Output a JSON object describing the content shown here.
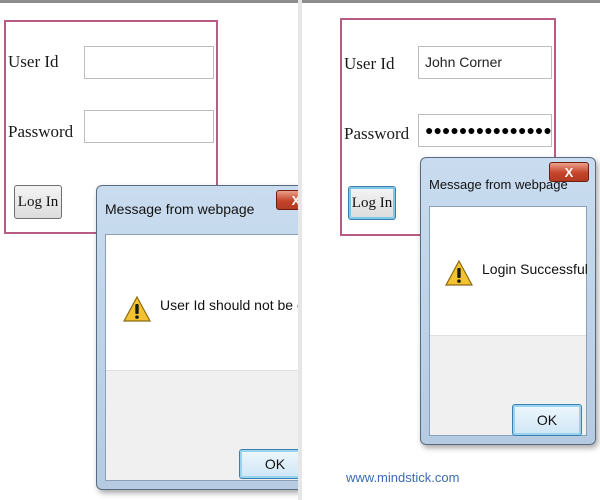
{
  "left_panel": {
    "form": {
      "user_id_label": "User Id",
      "user_id_value": "",
      "password_label": "Password",
      "password_value": "",
      "login_button": "Log In"
    },
    "dialog": {
      "title": "Message from webpage",
      "close_glyph": "X",
      "icon": "warning-icon",
      "message": "User Id should not be empty",
      "ok_button": "OK"
    }
  },
  "right_panel": {
    "form": {
      "user_id_label": "User Id",
      "user_id_value": "John Corner",
      "password_label": "Password",
      "password_masked": "●●●●●●●●●●●●●●●●●●●",
      "login_button": "Log In"
    },
    "dialog": {
      "title": "Message from webpage",
      "close_glyph": "X",
      "icon": "warning-icon",
      "message": "Login Successful",
      "ok_button": "OK"
    },
    "watermark": "www.mindstick.com"
  },
  "colors": {
    "form_border": "#b85c86",
    "dialog_frame": "#c9dcef",
    "close_button": "#c5442a",
    "watermark": "#3a6bb5"
  }
}
